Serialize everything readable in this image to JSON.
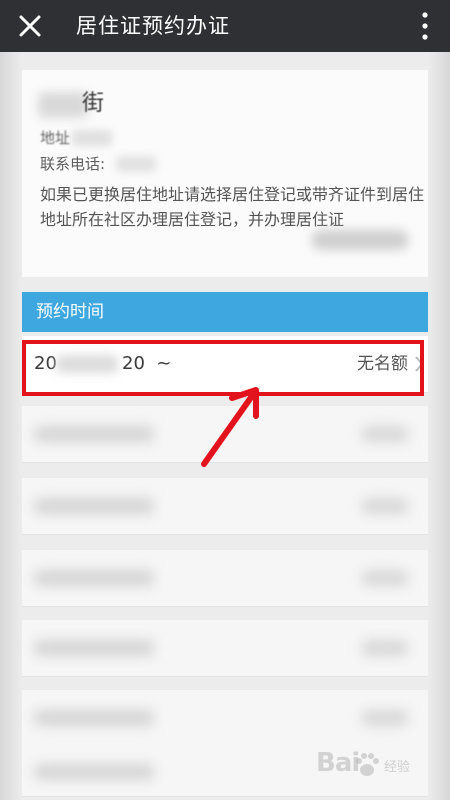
{
  "titlebar": {
    "title": "居住证预约办证",
    "close_icon": "close-icon",
    "more_icon": "more-vertical-icon"
  },
  "info": {
    "name_char": "街",
    "address_label": "地址",
    "phone_label": "联系电话:",
    "notice": "如果已更换居住地址请选择居住登记或带齐证件到居住地址所在社区办理居住登记，并办理居住证"
  },
  "section": {
    "header": "预约时间"
  },
  "slots": [
    {
      "date_prefix": "20",
      "date_suffix": "20  ~",
      "quota": "无名额"
    }
  ],
  "colors": {
    "titlebar": "#2f3033",
    "section_header": "#3ea7df",
    "highlight": "#e3131d"
  },
  "watermark": {
    "brand": "Bai",
    "sub": "经验"
  }
}
